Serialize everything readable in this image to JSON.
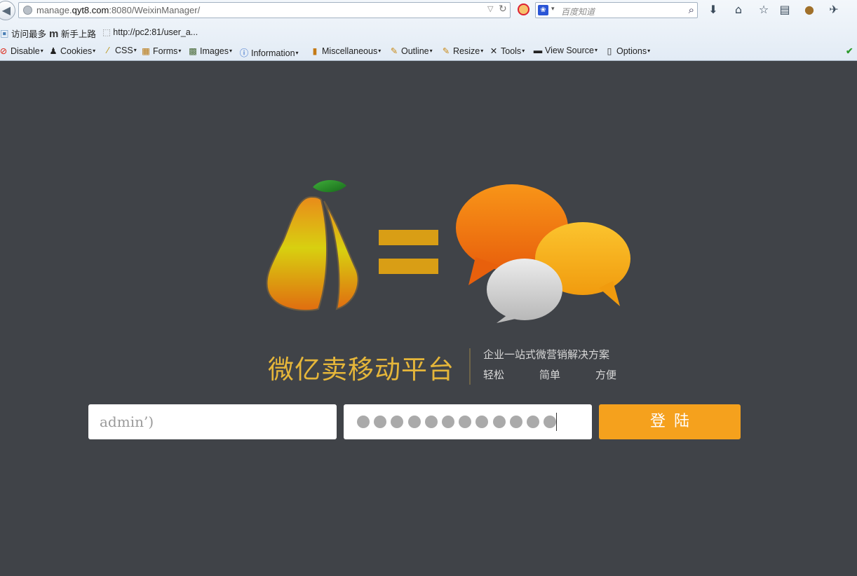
{
  "browser": {
    "url_path": "manage.",
    "url_host": "qyt8.com",
    "url_rest": ":8080/WeixinManager/",
    "search_placeholder": "百度知道",
    "bookmarks": [
      {
        "label": "访问最多",
        "icon": "folder-icon"
      },
      {
        "label": "新手上路",
        "icon": "m-logo-icon"
      },
      {
        "label": "http://pc2:81/user_a...",
        "icon": "page-icon"
      }
    ],
    "webdev_toolbar": [
      {
        "label": "Disable",
        "icon": "disable-icon"
      },
      {
        "label": "Cookies",
        "icon": "cookie-user-icon"
      },
      {
        "label": "CSS",
        "icon": "css-wand-icon"
      },
      {
        "label": "Forms",
        "icon": "forms-icon"
      },
      {
        "label": "Images",
        "icon": "images-icon"
      },
      {
        "label": "Information",
        "icon": "info-icon"
      },
      {
        "label": "Miscellaneous",
        "icon": "misc-icon"
      },
      {
        "label": "Outline",
        "icon": "outline-pencil-icon"
      },
      {
        "label": "Resize",
        "icon": "resize-icon"
      },
      {
        "label": "Tools",
        "icon": "tools-icon"
      },
      {
        "label": "View Source",
        "icon": "view-source-icon"
      },
      {
        "label": "Options",
        "icon": "options-icon"
      }
    ]
  },
  "page": {
    "title": "微亿卖移动平台",
    "tagline": "企业一站式微营销解决方案",
    "features": [
      "轻松",
      "简单",
      "方便"
    ],
    "username_value": "admin’)",
    "password_dots": 12,
    "login_label": "登陆",
    "colors": {
      "background": "#404348",
      "accent": "#f5a11d",
      "title": "#e5b63a"
    }
  }
}
